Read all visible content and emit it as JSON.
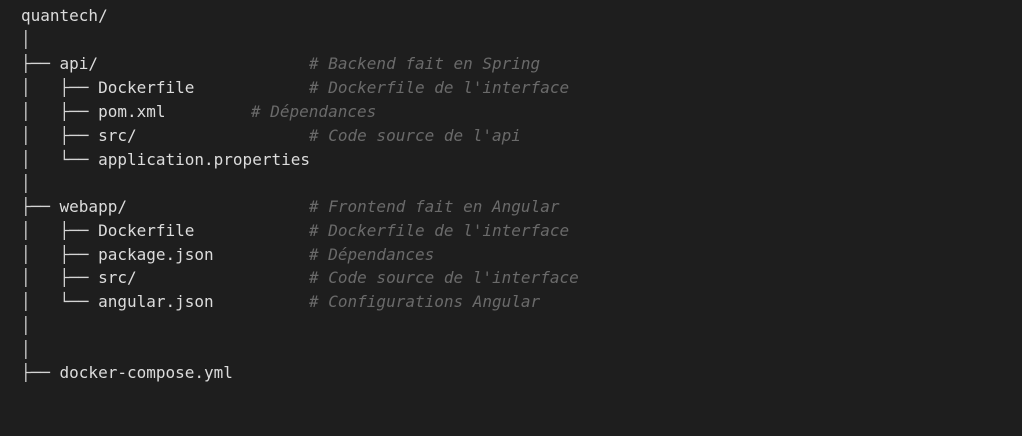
{
  "lines": [
    {
      "tree": "",
      "name": "quantech/",
      "comment": ""
    },
    {
      "tree": "│",
      "name": "",
      "comment": ""
    },
    {
      "tree": "├── ",
      "name": "api/",
      "comment": "# Backend fait en Spring"
    },
    {
      "tree": "│   ├── ",
      "name": "Dockerfile",
      "comment": "# Dockerfile de l'interface"
    },
    {
      "tree": "│   ├── ",
      "name": "pom.xml",
      "comment": "# Dépendances"
    },
    {
      "tree": "│   ├── ",
      "name": "src/",
      "comment": "# Code source de l'api"
    },
    {
      "tree": "│   └── ",
      "name": "application.properties",
      "comment": ""
    },
    {
      "tree": "│",
      "name": "",
      "comment": ""
    },
    {
      "tree": "├── ",
      "name": "webapp/",
      "comment": "# Frontend fait en Angular"
    },
    {
      "tree": "│   ├── ",
      "name": "Dockerfile",
      "comment": "# Dockerfile de l'interface"
    },
    {
      "tree": "│   ├── ",
      "name": "package.json",
      "comment": "# Dépendances"
    },
    {
      "tree": "│   ├── ",
      "name": "src/",
      "comment": "# Code source de l'interface"
    },
    {
      "tree": "│   └── ",
      "name": "angular.json",
      "comment": "# Configurations Angular"
    },
    {
      "tree": "│",
      "name": "",
      "comment": ""
    },
    {
      "tree": "│",
      "name": "",
      "comment": ""
    },
    {
      "tree": "├── ",
      "name": "docker-compose.yml",
      "comment": ""
    }
  ]
}
